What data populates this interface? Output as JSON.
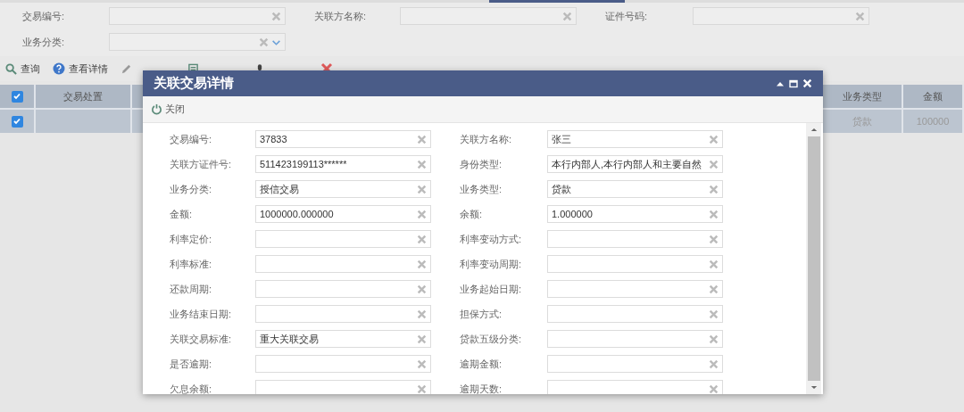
{
  "filters": [
    {
      "label": "交易编号:",
      "kind": "text"
    },
    {
      "label": "关联方名称:",
      "kind": "text"
    },
    {
      "label": "证件号码:",
      "kind": "text"
    },
    {
      "label": "业务分类:",
      "kind": "combo"
    }
  ],
  "toolbar": [
    {
      "label": "查询",
      "kind": "search"
    },
    {
      "label": "查看详情",
      "kind": "help"
    },
    {
      "kind": "edit"
    },
    {
      "kind": "doc"
    },
    {
      "kind": "mic"
    },
    {
      "kind": "close"
    }
  ],
  "table": {
    "all_checked": true,
    "columns": [
      {
        "label": "交易处置"
      },
      {
        "label": "业务类型"
      },
      {
        "label": "金额"
      }
    ],
    "rows": [
      {
        "checked": true,
        "cells": [
          "",
          "贷款",
          "100000"
        ]
      }
    ]
  },
  "dialog": {
    "title": "关联交易详情",
    "close_button": "关闭",
    "fields": [
      {
        "label": "交易编号:",
        "value": "37833"
      },
      {
        "label": "关联方名称:",
        "value": "张三"
      },
      {
        "label": "关联方证件号:",
        "value": "511423199113******"
      },
      {
        "label": "身份类型:",
        "value": "本行内部人,本行内部人和主要自然"
      },
      {
        "label": "业务分类:",
        "value": "授信交易"
      },
      {
        "label": "业务类型:",
        "value": "贷款"
      },
      {
        "label": "金额:",
        "value": "1000000.000000"
      },
      {
        "label": "余额:",
        "value": "1.000000"
      },
      {
        "label": "利率定价:"
      },
      {
        "label": "利率变动方式:"
      },
      {
        "label": "利率标准:"
      },
      {
        "label": "利率变动周期:"
      },
      {
        "label": "还款周期:"
      },
      {
        "label": "业务起始日期:"
      },
      {
        "label": "业务结束日期:"
      },
      {
        "label": "担保方式:"
      },
      {
        "label": "关联交易标准:",
        "value": "重大关联交易"
      },
      {
        "label": "贷款五级分类:"
      },
      {
        "label": "是否逾期:"
      },
      {
        "label": "逾期金额:"
      },
      {
        "label": "欠息余额:"
      },
      {
        "label": "逾期天数:"
      }
    ]
  }
}
